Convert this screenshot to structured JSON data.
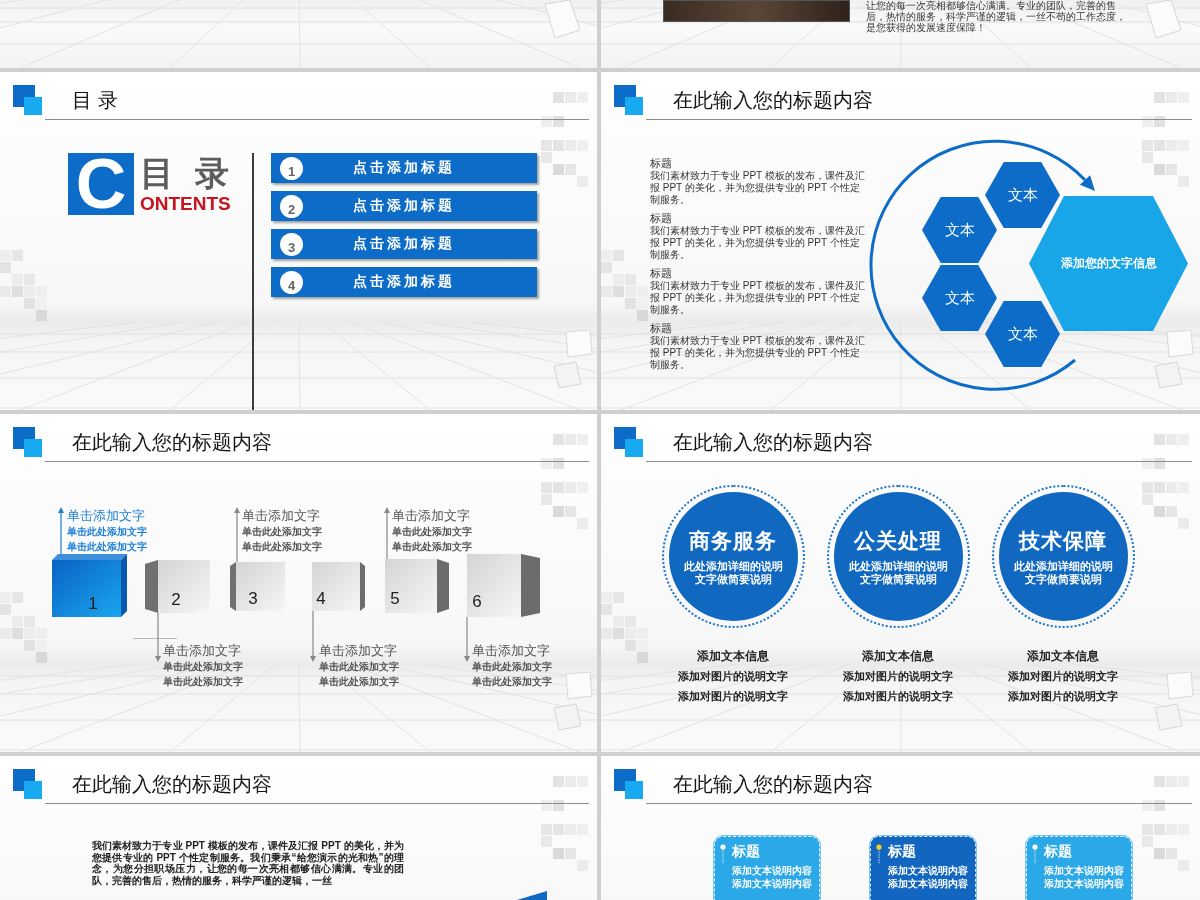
{
  "slides": [
    {
      "kind": "floor"
    },
    {
      "kind": "photo-text",
      "text": "让您的每一次亮相都够信心满满。专业的团队，完善的售后，热情的服务，科学严谨的逻辑，一丝不苟的工作态度，是您获得的发展速度保障！"
    },
    {
      "kind": "contents",
      "title": "目 录",
      "mark": {
        "letter": "C",
        "title": "目 录",
        "subtitle": "ONTENTS"
      },
      "entries": [
        {
          "number": "1",
          "label": "点击添加标题"
        },
        {
          "number": "2",
          "label": "点击添加标题"
        },
        {
          "number": "3",
          "label": "点击添加标题"
        },
        {
          "number": "4",
          "label": "点击添加标题"
        }
      ]
    },
    {
      "kind": "hexagons",
      "title": "在此输入您的标题内容",
      "blocks": [
        {
          "heading": "标题",
          "text": "我们素材致力于专业 PPT 模板的发布，课件及汇报 PPT 的美化，并为您提供专业的 PPT 个性定制服务。"
        },
        {
          "heading": "标题",
          "text": "我们素材致力于专业 PPT 模板的发布，课件及汇报 PPT 的美化，并为您提供专业的 PPT 个性定制服务。"
        },
        {
          "heading": "标题",
          "text": "我们素材致力于专业 PPT 模板的发布，课件及汇报 PPT 的美化，并为您提供专业的 PPT 个性定制服务。"
        },
        {
          "heading": "标题",
          "text": "我们素材致力于专业 PPT 模板的发布，课件及汇报 PPT 的美化，并为您提供专业的 PPT 个性定制服务。"
        }
      ],
      "hexagons": [
        "文本",
        "文本",
        "文本",
        "文本"
      ],
      "center_text": "添加您的文字信息"
    },
    {
      "kind": "steps",
      "title": "在此输入您的标题内容",
      "steps": [
        {
          "number": "1",
          "kind": "above",
          "selected": true,
          "heading": "单击添加文字",
          "lines": [
            "单击此处添加文字",
            "单击此处添加文字"
          ]
        },
        {
          "number": "2",
          "kind": "below",
          "selected": false,
          "heading": "单击添加文字",
          "lines": [
            "单击此处添加文字",
            "单击此处添加文字"
          ]
        },
        {
          "number": "3",
          "kind": "above",
          "selected": false,
          "heading": "单击添加文字",
          "lines": [
            "单击此处添加文字",
            "单击此处添加文字"
          ]
        },
        {
          "number": "4",
          "kind": "below",
          "selected": false,
          "heading": "单击添加文字",
          "lines": [
            "单击此处添加文字",
            "单击此处添加文字"
          ]
        },
        {
          "number": "5",
          "kind": "above",
          "selected": false,
          "heading": "单击添加文字",
          "lines": [
            "单击此处添加文字",
            "单击此处添加文字"
          ]
        },
        {
          "number": "6",
          "kind": "below",
          "selected": false,
          "heading": "单击添加文字",
          "lines": [
            "单击此处添加文字",
            "单击此处添加文字"
          ]
        }
      ]
    },
    {
      "kind": "circles",
      "title": "在此输入您的标题内容",
      "services": [
        {
          "name": "商务服务",
          "description": [
            "此处添加详细的说明",
            "文字做简要说明"
          ],
          "caption": "添加文本信息",
          "notes": [
            "添加对图片的说明文字",
            "添加对图片的说明文字"
          ]
        },
        {
          "name": "公关处理",
          "description": [
            "此处添加详细的说明",
            "文字做简要说明"
          ],
          "caption": "添加文本信息",
          "notes": [
            "添加对图片的说明文字",
            "添加对图片的说明文字"
          ]
        },
        {
          "name": "技术保障",
          "description": [
            "此处添加详细的说明",
            "文字做简要说明"
          ],
          "caption": "添加文本信息",
          "notes": [
            "添加对图片的说明文字",
            "添加对图片的说明文字"
          ]
        }
      ]
    },
    {
      "kind": "text",
      "title": "在此输入您的标题内容",
      "paragraph": "我们素材致力于专业 PPT 模板的发布，课件及汇报 PPT 的美化，并为您提供专业的 PPT 个性定制服务。我们秉承“给您演示的光和热”的理念，为您分担职场压力，让您的每一次亮相都够信心满满。专业的团队，完善的售后，热情的服务，科学严谨的逻辑，一丝"
    },
    {
      "kind": "cards",
      "title": "在此输入您的标题内容",
      "cards": [
        {
          "heading": "标题",
          "lines": [
            "添加文本说明内容",
            "添加文本说明内容"
          ],
          "color": "#2ba8e8",
          "marker": {
            "color": "#ffffff"
          }
        },
        {
          "heading": "标题",
          "lines": [
            "添加文本说明内容",
            "添加文本说明内容"
          ],
          "color": "#1266c0",
          "marker": {
            "color": "#f5d020"
          }
        },
        {
          "heading": "标题",
          "lines": [
            "添加文本说明内容",
            "添加文本说明内容"
          ],
          "color": "#2ba8e8",
          "marker": {
            "color": "#ffffff"
          }
        }
      ]
    }
  ]
}
